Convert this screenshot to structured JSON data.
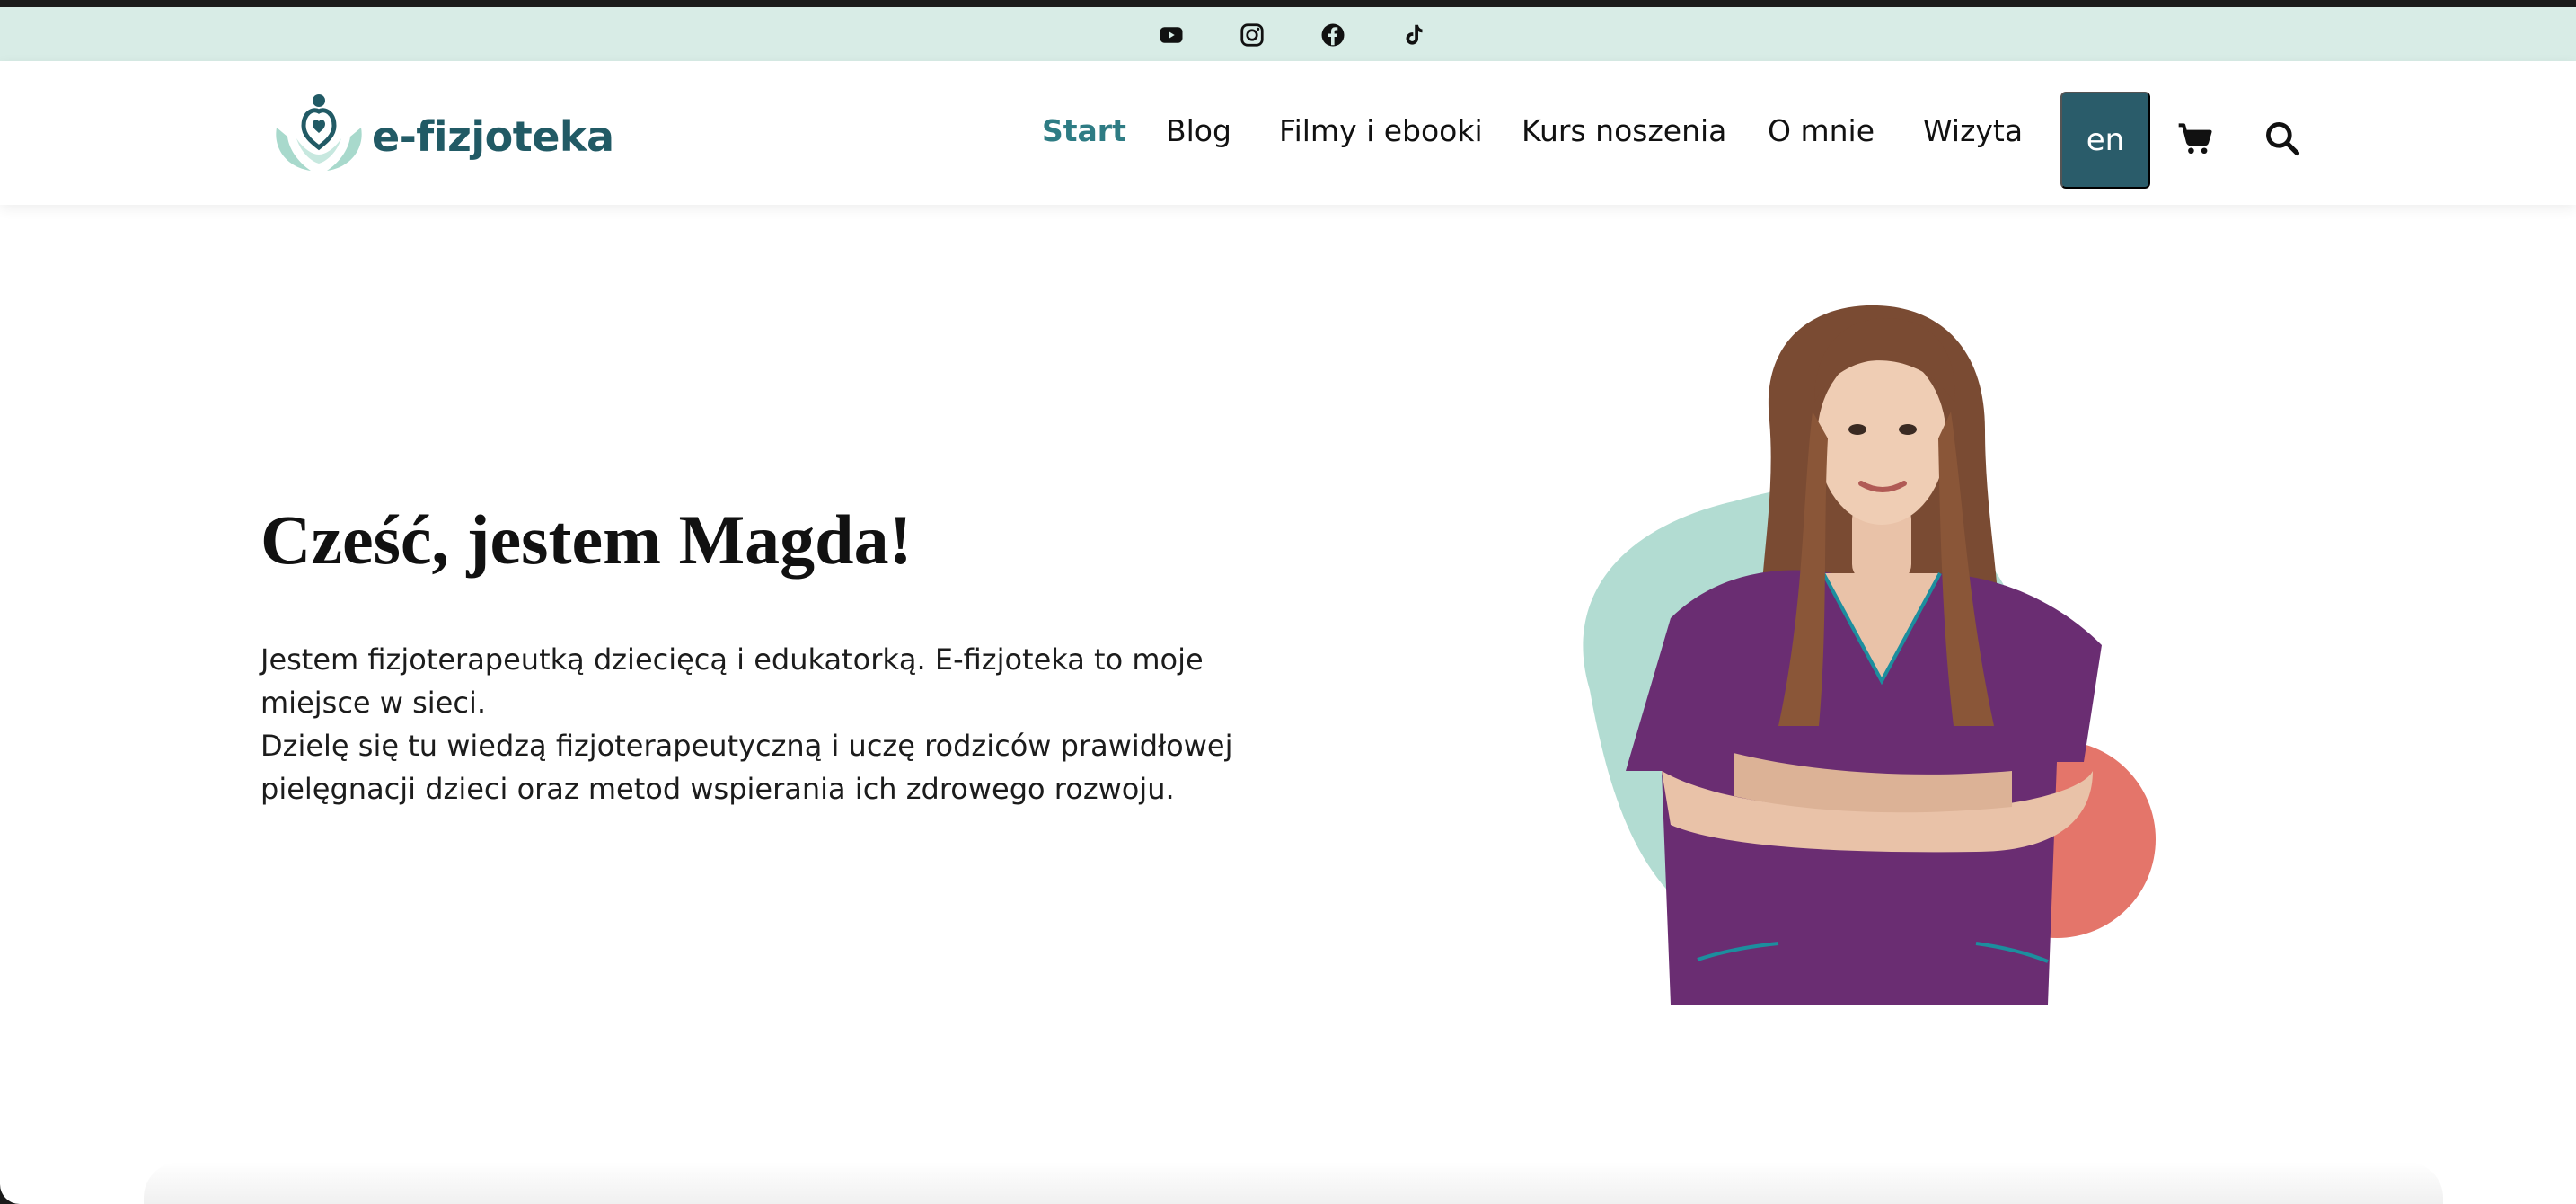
{
  "social": {
    "icons": [
      "youtube-icon",
      "instagram-icon",
      "facebook-icon",
      "tiktok-icon"
    ]
  },
  "header": {
    "logo_text": "e-fizjoteka",
    "nav": [
      {
        "label": "Start",
        "active": true
      },
      {
        "label": "Blog",
        "active": false
      },
      {
        "label": "Filmy i ebooki",
        "active": false
      },
      {
        "label": "Kurs noszenia",
        "active": false
      },
      {
        "label": "O mnie",
        "active": false
      },
      {
        "label": "Wizyta",
        "active": false
      }
    ],
    "lang_label": "en",
    "cart_icon": "cart-icon",
    "search_icon": "search-icon"
  },
  "hero": {
    "title": "Cześć, jestem Magda!",
    "paragraph_1": "Jestem fizjoterapeutką dziecięcą i edukatorką. E-fizjoteka to moje miejsce w sieci.",
    "paragraph_2": "Dzielę się tu wiedzą fizjoterapeutyczną i uczę rodziców prawidłowej pielęgnacji dzieci oraz metod wspierania ich zdrowego rozwoju."
  },
  "colors": {
    "top_bar": "#d8ece6",
    "brand_teal": "#215a65",
    "nav_active": "#2e7c84",
    "lang_button": "#2a5c6a",
    "blob_mint": "#b2dcd2",
    "blob_coral": "#e4756a",
    "scrubs_purple": "#6a2d72"
  }
}
